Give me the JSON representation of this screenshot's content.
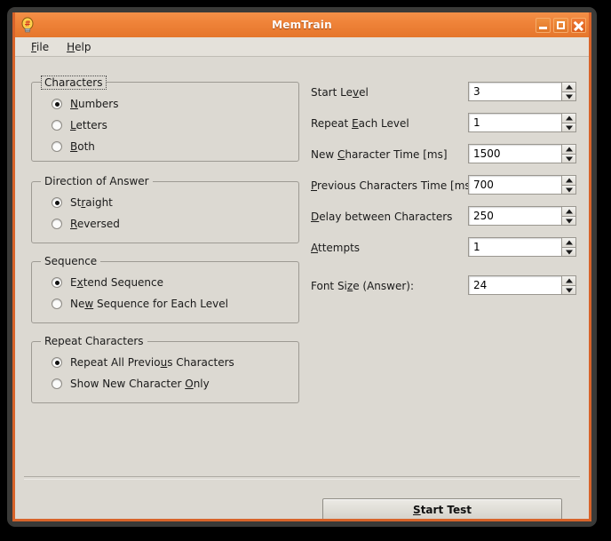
{
  "window": {
    "title": "MemTrain",
    "icon": "lightbulb-hash-icon",
    "controls": {
      "minimize": "minimize-icon",
      "maximize": "maximize-icon",
      "close": "close-icon"
    },
    "accent_color": "#e8792f",
    "frame_color": "#3a3a38",
    "panel_color": "#dcd9d2"
  },
  "menu": {
    "items": [
      {
        "label": "File",
        "mnemonic": "F"
      },
      {
        "label": "Help",
        "mnemonic": "H"
      }
    ]
  },
  "groups": [
    {
      "legend": "Characters",
      "focused": true,
      "options": [
        {
          "label": "Numbers",
          "mnemonic": "N",
          "checked": true
        },
        {
          "label": "Letters",
          "mnemonic": "L",
          "checked": false
        },
        {
          "label": "Both",
          "mnemonic": "B",
          "checked": false
        }
      ]
    },
    {
      "legend": "Direction of Answer",
      "focused": false,
      "options": [
        {
          "label": "Straight",
          "mnemonic": "r",
          "checked": true
        },
        {
          "label": "Reversed",
          "mnemonic": "R",
          "checked": false
        }
      ]
    },
    {
      "legend": "Sequence",
      "focused": false,
      "options": [
        {
          "label": "Extend Sequence",
          "mnemonic": "x",
          "checked": true
        },
        {
          "label": "New Sequence for Each Level",
          "mnemonic": "w",
          "checked": false
        }
      ]
    },
    {
      "legend": "Repeat Characters",
      "focused": false,
      "options": [
        {
          "label": "Repeat All Previous Characters",
          "mnemonic": "u",
          "checked": true
        },
        {
          "label": "Show New Character Only",
          "mnemonic": "O",
          "checked": false
        }
      ]
    }
  ],
  "fields": [
    {
      "label": "Start Level",
      "mnemonic": "v",
      "value": "3"
    },
    {
      "label": "Repeat Each Level",
      "mnemonic": "E",
      "value": "1"
    },
    {
      "label": "New Character Time [ms]",
      "mnemonic": "C",
      "value": "1500"
    },
    {
      "label": "Previous Characters Time [ms]",
      "mnemonic": "P",
      "value": "700"
    },
    {
      "label": "Delay between Characters",
      "mnemonic": "D",
      "value": "250"
    },
    {
      "label": "Attempts",
      "mnemonic": "A",
      "value": "1"
    },
    {
      "label": "Font Size (Answer):",
      "mnemonic": "z",
      "value": "24"
    }
  ],
  "actions": {
    "start_test": {
      "label": "Start Test",
      "mnemonic": "S"
    }
  }
}
